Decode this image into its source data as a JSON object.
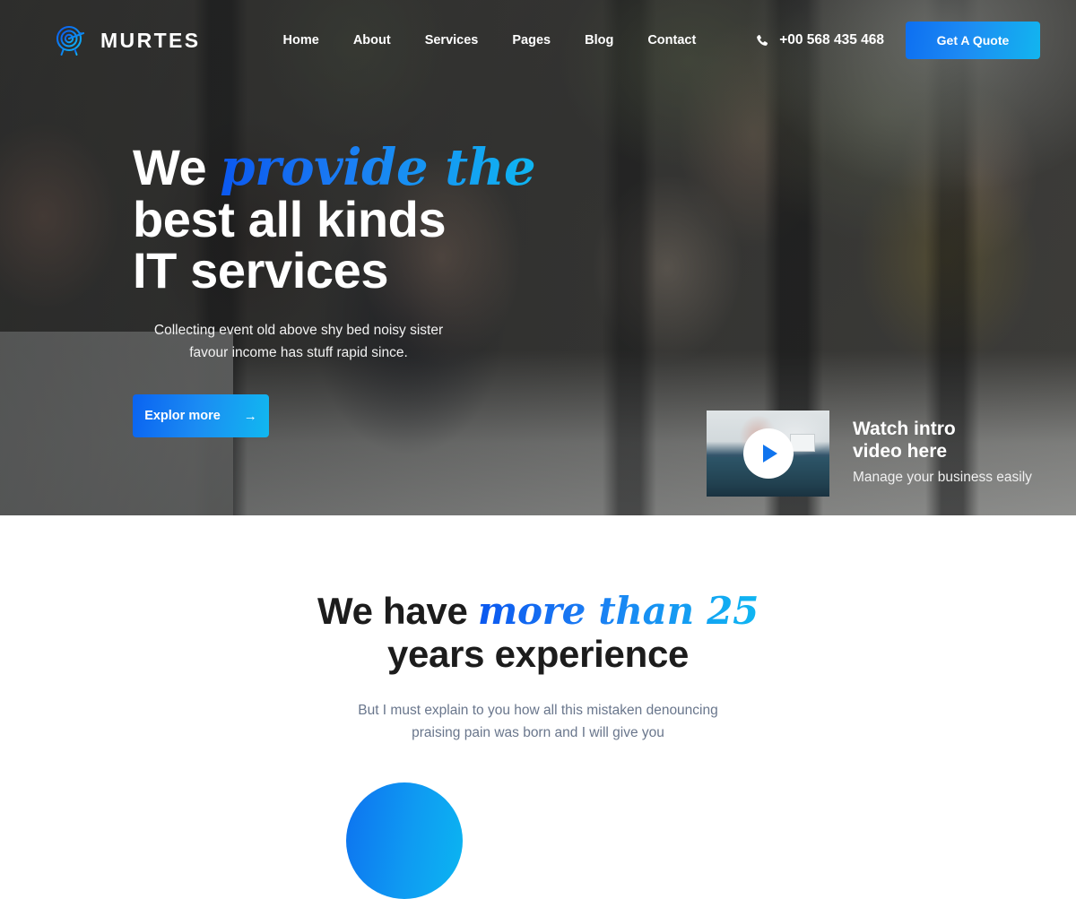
{
  "header": {
    "brand_name": "MURTES",
    "brand_icon": "target-arrow-logo",
    "nav": [
      {
        "label": "Home"
      },
      {
        "label": "About"
      },
      {
        "label": "Services"
      },
      {
        "label": "Pages"
      },
      {
        "label": "Blog"
      },
      {
        "label": "Contact"
      }
    ],
    "phone_icon": "phone-icon",
    "phone_number": "+00 568 435 468",
    "quote_button": "Get A Quote"
  },
  "hero": {
    "title_line1_plain": "We ",
    "title_line1_accent": "provide the",
    "title_line2": "best all kinds",
    "title_line3": "IT services",
    "subtitle_line1": "Collecting event old above shy bed noisy sister",
    "subtitle_line2": "favour income has stuff rapid since.",
    "cta_label": "Explor more",
    "cta_arrow": "→",
    "video": {
      "play_icon": "play-button-icon",
      "title_line1": "Watch intro",
      "title_line2": "video here",
      "caption": "Manage your business easily"
    }
  },
  "experience": {
    "title_plain_before": "We have ",
    "title_accent": "more than 25",
    "title_line2": "years experience",
    "subtitle_line1": "But I must explain to you how all this mistaken denouncing",
    "subtitle_line2": "praising pain was born and I will give you"
  },
  "colors": {
    "accent_blue_dark": "#0b58ef",
    "accent_blue_light": "#0fb6f2",
    "heading_dark": "#1c1c1c",
    "body_muted": "#69768c",
    "white": "#ffffff"
  }
}
